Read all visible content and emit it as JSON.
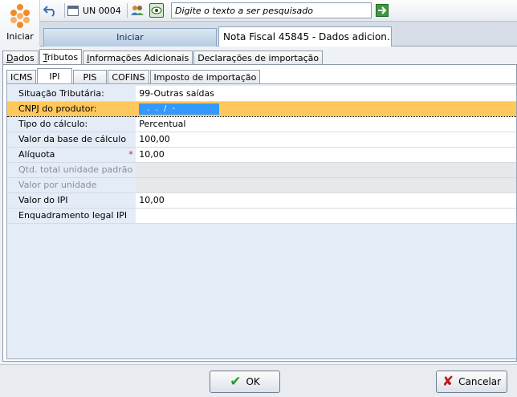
{
  "toolbar": {
    "home_label": "Iniciar",
    "unit": "UN 0004",
    "search_placeholder": "Digite o texto a ser pesquisado"
  },
  "window_tabs": [
    {
      "label": "Iniciar"
    },
    {
      "label": "Nota Fiscal 45845 - Dados adicion..."
    }
  ],
  "main_tabs": [
    {
      "label": "Dados",
      "underline": "D",
      "rest": "ados"
    },
    {
      "label": "Tributos",
      "underline": "T",
      "rest": "ributos"
    },
    {
      "label": "Informações Adicionais",
      "underline": "I",
      "rest": "nformações Adicionais"
    },
    {
      "label": "Declarações de importação"
    }
  ],
  "sub_tabs": [
    {
      "label": "ICMS"
    },
    {
      "label": "IPI"
    },
    {
      "label": "PIS"
    },
    {
      "label": "COFINS"
    },
    {
      "label": "Imposto de importação"
    }
  ],
  "fields": [
    {
      "label": "Situação Tributária:",
      "value": "99-Outras saídas"
    },
    {
      "label": "CNPJ do produtor:",
      "value": "  .   .   /    -"
    },
    {
      "label": "Tipo do cálculo:",
      "value": "Percentual"
    },
    {
      "label": "Valor da base de cálculo",
      "value": "100,00"
    },
    {
      "label": "Alíquota",
      "value": "10,00",
      "required_mark": "*"
    },
    {
      "label": "Qtd. total unidade padrão",
      "value": ""
    },
    {
      "label": "Valor por unidade",
      "value": ""
    },
    {
      "label": "Valor do IPI",
      "value": "10,00"
    },
    {
      "label": "Enquadramento legal IPI",
      "value": ""
    }
  ],
  "buttons": {
    "ok": "OK",
    "cancel": "Cancelar"
  },
  "colors": {
    "selected_row": "#ffc85c",
    "mask_highlight": "#3399ff",
    "grid_background": "#e4ecf7"
  },
  "icons": [
    "logo-icon",
    "undo-icon",
    "calendar-icon",
    "people-icon",
    "eye-icon",
    "go-arrow-icon",
    "check-icon",
    "x-icon"
  ]
}
